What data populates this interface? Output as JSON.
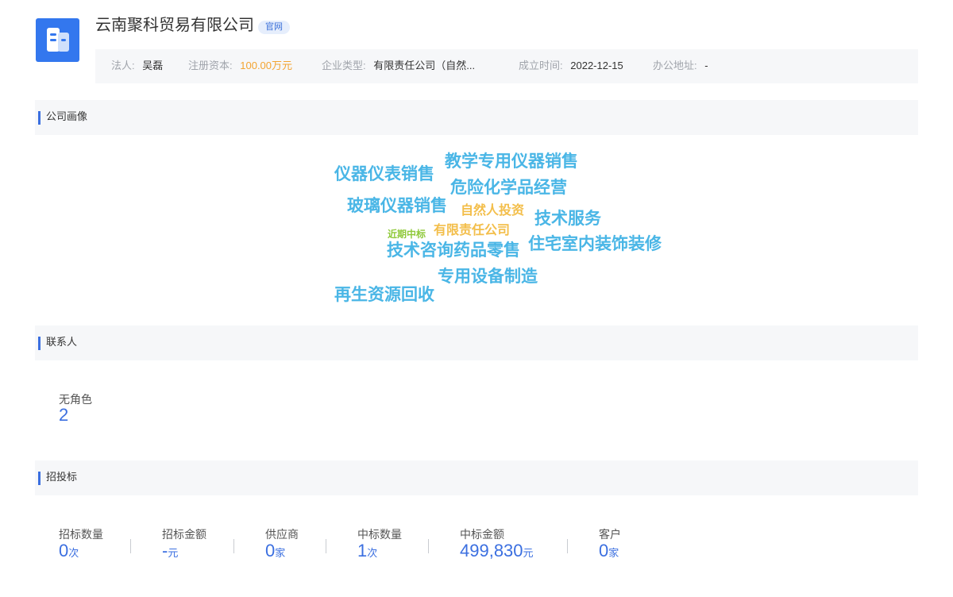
{
  "company": {
    "name": "云南聚科贸易有限公司",
    "badge": "官网"
  },
  "info": {
    "legal_person_label": "法人:",
    "legal_person": "吴磊",
    "capital_label": "注册资本:",
    "capital": "100.00万元",
    "type_label": "企业类型:",
    "type": "有限责任公司（自然...",
    "founded_label": "成立时间:",
    "founded": "2022-12-15",
    "address_label": "办公地址:",
    "address": "-"
  },
  "sections": {
    "profile": "公司画像",
    "contacts": "联系人",
    "bidding": "招投标"
  },
  "word_cloud": [
    {
      "text": "仪器仪表销售"
    },
    {
      "text": "教学专用仪器销售"
    },
    {
      "text": "危险化学品经营"
    },
    {
      "text": "玻璃仪器销售"
    },
    {
      "text": "自然人投资"
    },
    {
      "text": "技术服务"
    },
    {
      "text": "近期中标"
    },
    {
      "text": "有限责任公司"
    },
    {
      "text": "技术咨询药品零售"
    },
    {
      "text": "住宅室内装饰装修"
    },
    {
      "text": "专用设备制造"
    },
    {
      "text": "再生资源回收"
    }
  ],
  "contacts": {
    "role_label": "无角色",
    "role_count": "2"
  },
  "bidding": {
    "stats": [
      {
        "label": "招标数量",
        "value": "0",
        "unit": "次"
      },
      {
        "label": "招标金额",
        "value": "-",
        "unit": "元"
      },
      {
        "label": "供应商",
        "value": "0",
        "unit": "家"
      },
      {
        "label": "中标数量",
        "value": "1",
        "unit": "次"
      },
      {
        "label": "中标金额",
        "value": "499,830",
        "unit": "元"
      },
      {
        "label": "客户",
        "value": "0",
        "unit": "家"
      }
    ]
  },
  "colors": {
    "accent": "#3b6fe0",
    "cloud_blue": "#4ab6e6",
    "cloud_orange": "#f3be4a",
    "cloud_green": "#8fc93a"
  }
}
